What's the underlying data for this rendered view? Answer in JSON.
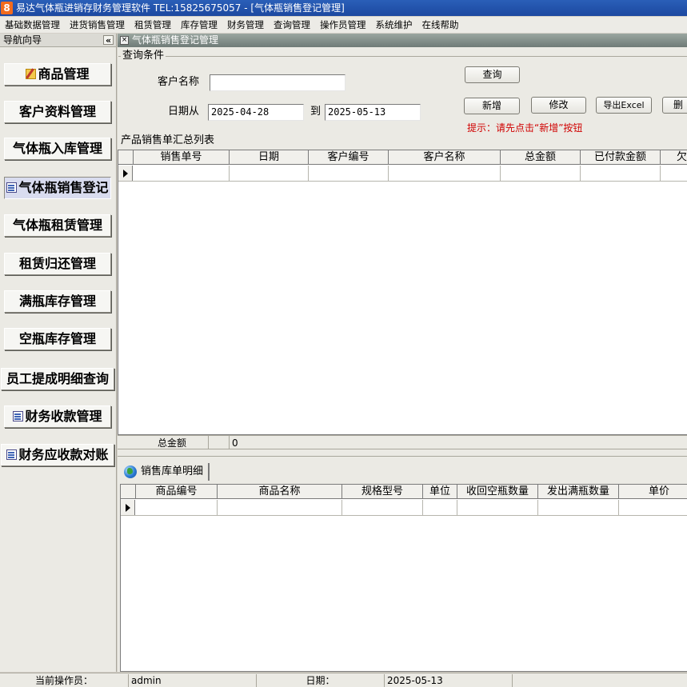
{
  "window": {
    "title": "易达气体瓶进销存财务管理软件  TEL:15825675057   - [气体瓶销售登记管理]",
    "icon_letter": "8"
  },
  "menu": [
    "基础数据管理",
    "进货销售管理",
    "租赁管理",
    "库存管理",
    "财务管理",
    "查询管理",
    "操作员管理",
    "系统维护",
    "在线帮助"
  ],
  "nav": {
    "header": "导航向导",
    "collapse_glyph": "«",
    "items": [
      {
        "label": "商品管理",
        "icon": "pen-edit-icon"
      },
      {
        "label": "客户资料管理"
      },
      {
        "label": "气体瓶入库管理"
      },
      {
        "label": "气体瓶销售登记",
        "icon": "document-icon",
        "active": true
      },
      {
        "label": "气体瓶租赁管理"
      },
      {
        "label": "租赁归还管理"
      },
      {
        "label": "满瓶库存管理"
      },
      {
        "label": "空瓶库存管理"
      },
      {
        "label": "员工提成明细查询"
      },
      {
        "label": "财务收款管理",
        "icon": "document-icon"
      },
      {
        "label": "财务应收款对账",
        "icon": "document-icon"
      }
    ]
  },
  "form": {
    "window_title": "气体瓶销售登记管理",
    "group_title": "查询条件",
    "customer_label": "客户名称",
    "customer_value": "",
    "date_from_label": "日期从",
    "date_from": "2025-04-28",
    "to_label": "到",
    "date_to": "2025-05-13",
    "buttons": {
      "query": "查询",
      "add": "新增",
      "edit": "修改",
      "export": "导出Excel",
      "delete": "删"
    },
    "hint": "提示：请先点击“新增”按钮"
  },
  "summary_table": {
    "title": "产品销售单汇总列表",
    "columns": [
      "销售单号",
      "日期",
      "客户编号",
      "客户名称",
      "总金额",
      "已付款金额",
      "欠"
    ],
    "total_label": "总金额",
    "total_value": "0"
  },
  "detail_table": {
    "tab_label": "销售库单明细",
    "columns": [
      "商品编号",
      "商品名称",
      "规格型号",
      "单位",
      "收回空瓶数量",
      "发出满瓶数量",
      "单价"
    ]
  },
  "status": {
    "operator_label": "当前操作员：",
    "operator": "admin",
    "date_label": "日期：",
    "date": "2025-05-13"
  },
  "colors": {
    "title_bar": "#1c48a0",
    "hint_text": "#d00000",
    "active_nav": "#d9dcef"
  }
}
